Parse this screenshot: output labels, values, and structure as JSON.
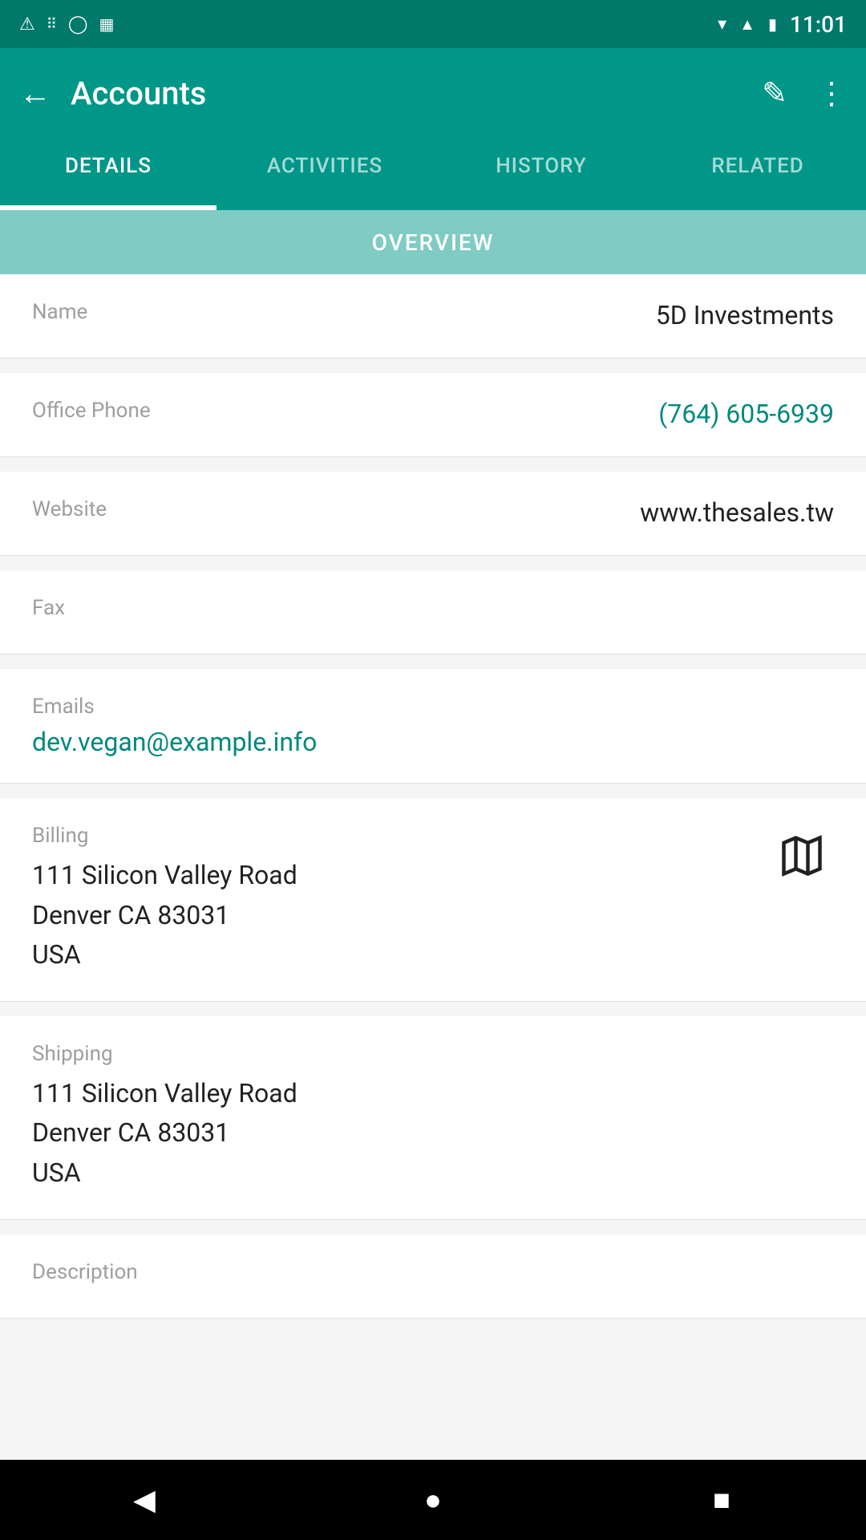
{
  "statusBar": {
    "time": "11:01",
    "icons": [
      "warning",
      "dots",
      "circle",
      "sim"
    ]
  },
  "appBar": {
    "title": "Accounts",
    "backLabel": "←",
    "editIcon": "✎",
    "moreIcon": "⋮"
  },
  "tabs": [
    {
      "id": "details",
      "label": "DETAILS",
      "active": true
    },
    {
      "id": "activities",
      "label": "ACTIVITIES",
      "active": false
    },
    {
      "id": "history",
      "label": "HISTORY",
      "active": false
    },
    {
      "id": "related",
      "label": "RELATED",
      "active": false
    }
  ],
  "overview": {
    "label": "OVERVIEW"
  },
  "fields": {
    "name": {
      "label": "Name",
      "value": "5D Investments"
    },
    "officePhone": {
      "label": "Office Phone",
      "value": "(764) 605-6939"
    },
    "website": {
      "label": "Website",
      "value": "www.thesales.tw"
    },
    "fax": {
      "label": "Fax",
      "value": ""
    },
    "emails": {
      "label": "Emails",
      "value": "dev.vegan@example.info"
    },
    "billing": {
      "label": "Billing",
      "line1": "111 Silicon Valley Road",
      "line2": "Denver CA 83031",
      "line3": "USA"
    },
    "shipping": {
      "label": "Shipping",
      "line1": "111 Silicon Valley Road",
      "line2": "Denver CA 83031",
      "line3": "USA"
    },
    "description": {
      "label": "Description",
      "value": ""
    }
  },
  "bottomNav": {
    "back": "◀",
    "home": "●",
    "recent": "■"
  }
}
